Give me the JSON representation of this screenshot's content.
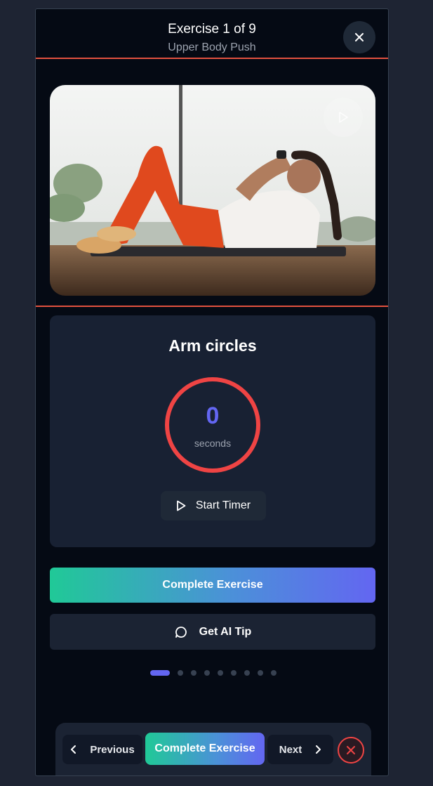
{
  "header": {
    "title": "Exercise 1 of 9",
    "subtitle": "Upper Body Push",
    "close_icon": "close-icon"
  },
  "media": {
    "image": "woman doing crunches on exercise mat",
    "play_icon": "play-icon"
  },
  "exercise": {
    "name": "Arm circles",
    "timer_value": "0",
    "timer_unit": "seconds",
    "start_label": "Start Timer",
    "start_icon": "play-icon"
  },
  "actions": {
    "complete_label": "Complete Exercise",
    "ai_tip_label": "Get AI Tip",
    "ai_tip_icon": "chat-bubble-icon"
  },
  "progress": {
    "total": 9,
    "current": 1
  },
  "bottom_nav": {
    "previous_label": "Previous",
    "complete_label": "Complete Exercise",
    "next_label": "Next",
    "cancel_icon": "x-circle-icon"
  },
  "colors": {
    "accent": "#6366f1",
    "gradient_start": "#20c997",
    "danger": "#ef4444",
    "background": "#050a14"
  }
}
